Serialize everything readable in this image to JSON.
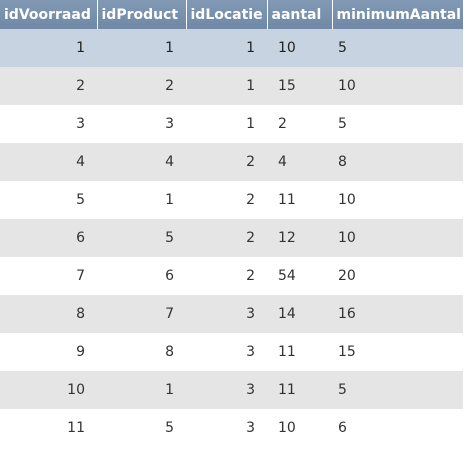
{
  "table": {
    "headers": [
      "idVoorraad",
      "idProduct",
      "idLocatie",
      "aantal",
      "minimumAantal"
    ],
    "rows": [
      [
        "1",
        "1",
        "1",
        "10",
        "5"
      ],
      [
        "2",
        "2",
        "1",
        "15",
        "10"
      ],
      [
        "3",
        "3",
        "1",
        "2",
        "5"
      ],
      [
        "4",
        "4",
        "2",
        "4",
        "8"
      ],
      [
        "5",
        "1",
        "2",
        "11",
        "10"
      ],
      [
        "6",
        "5",
        "2",
        "12",
        "10"
      ],
      [
        "7",
        "6",
        "2",
        "54",
        "20"
      ],
      [
        "8",
        "7",
        "3",
        "14",
        "16"
      ],
      [
        "9",
        "8",
        "3",
        "11",
        "15"
      ],
      [
        "10",
        "1",
        "3",
        "11",
        "5"
      ],
      [
        "11",
        "5",
        "3",
        "10",
        "6"
      ]
    ],
    "selected_row_index": 0,
    "colors": {
      "header_bg": "#7891ad",
      "selected_row_bg": "#c7d3e1",
      "alt_row_bg": "#e5e5e5"
    }
  }
}
